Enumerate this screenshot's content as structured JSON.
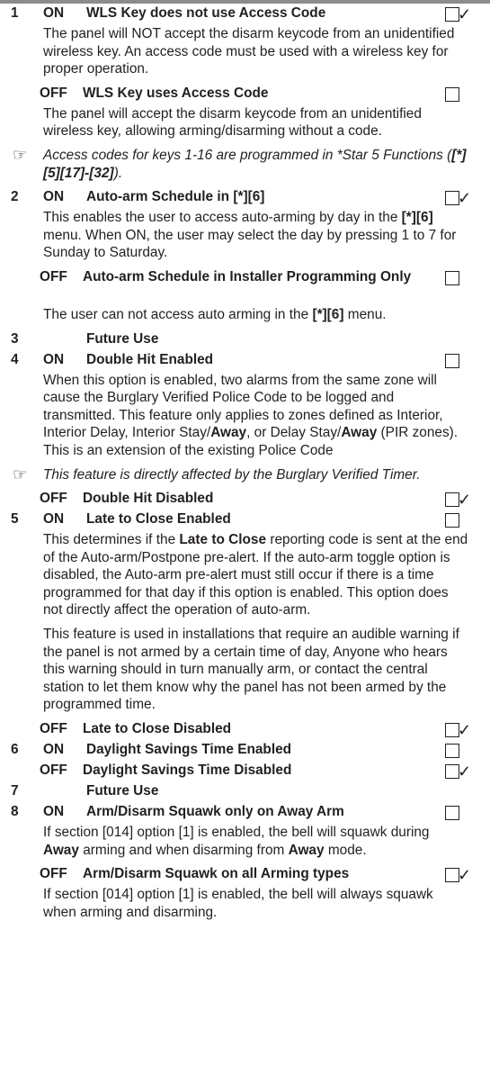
{
  "rows": [
    {
      "type": "opt",
      "num": "1",
      "state": "ON",
      "title": "WLS Key does not use Access Code",
      "checked": true
    },
    {
      "type": "para",
      "text": "The panel will NOT accept the disarm keycode from an unidentified wireless key. An access code must be used with a wireless key for proper operation."
    },
    {
      "type": "opt",
      "num": "",
      "state": "OFF",
      "title": "WLS Key uses Access Code",
      "checked": false
    },
    {
      "type": "para",
      "text": "The panel will accept the disarm keycode from an unidentified wireless key, allowing arming/disarming without a code."
    },
    {
      "type": "note",
      "text": "Access codes for keys 1-16 are programmed in *Star 5 Functions ([*][5][17]-[32])."
    },
    {
      "type": "opt",
      "num": "2",
      "state": "ON",
      "title": "Auto-arm Schedule in [*][6]",
      "checked": true
    },
    {
      "type": "para",
      "text": "This enables the user to access auto-arming by day in the [*][6] menu. When ON, the user may select the day by pressing 1 to 7 for Sunday to Saturday."
    },
    {
      "type": "opt",
      "num": "",
      "state": "OFF",
      "title": "Auto-arm Schedule in Installer Programming Only",
      "checked": false,
      "wrap": true
    },
    {
      "type": "para",
      "text": "The user can not access auto arming in the [*][6] menu."
    },
    {
      "type": "opt",
      "num": "3",
      "state": "",
      "title": "Future Use",
      "nobox": true
    },
    {
      "type": "opt",
      "num": "4",
      "state": "ON",
      "title": "Double Hit Enabled",
      "checked": false
    },
    {
      "type": "para",
      "text": "When this option is enabled, two alarms from the same zone will cause the Burglary Verified Police Code to be logged and transmitted. This feature only applies to zones defined as Interior, Interior Delay, Interior Stay/Away, or Delay Stay/Away (PIR zones). This is an extension of the existing Police Code"
    },
    {
      "type": "note",
      "text": "This feature is directly affected by the Burglary Verified Timer."
    },
    {
      "type": "opt",
      "num": "",
      "state": "OFF",
      "title": "Double Hit Disabled",
      "checked": true
    },
    {
      "type": "opt",
      "num": "5",
      "state": "ON",
      "title": "Late to Close Enabled",
      "checked": false
    },
    {
      "type": "para",
      "text": "This determines if the Late to Close reporting code is sent at the end of the Auto-arm/Postpone pre-alert. If the auto-arm toggle option is disabled, the Auto-arm pre-alert must still occur if there is a time programmed for that day if this option is enabled. This option does not directly affect the operation of auto-arm."
    },
    {
      "type": "para",
      "text": "This feature is used in installations that require an audible warning if the panel is not armed by a certain time of day, Anyone who hears this warning should in turn manually arm, or contact the central station to let them know why the panel has not been armed by the programmed time."
    },
    {
      "type": "opt",
      "num": "",
      "state": "OFF",
      "title": "Late to Close Disabled",
      "checked": true
    },
    {
      "type": "opt",
      "num": "6",
      "state": "ON",
      "title": "Daylight Savings Time Enabled",
      "checked": false
    },
    {
      "type": "opt",
      "num": "",
      "state": "OFF",
      "title": "Daylight Savings Time Disabled",
      "checked": true
    },
    {
      "type": "opt",
      "num": "7",
      "state": "",
      "title": "Future Use",
      "nobox": true
    },
    {
      "type": "opt",
      "num": "8",
      "state": "ON",
      "title": "Arm/Disarm Squawk only on Away Arm",
      "checked": false
    },
    {
      "type": "para",
      "text": "If section [014] option [1] is enabled, the bell will squawk during Away arming and when disarming from Away mode."
    },
    {
      "type": "opt",
      "num": "",
      "state": "OFF",
      "title": "Arm/Disarm Squawk on all Arming types",
      "checked": true
    },
    {
      "type": "para",
      "text": "If section [014] option [1] is enabled, the bell will always squawk when arming and disarming."
    }
  ],
  "icons": {
    "note": "hand-pointer-icon",
    "check": "checkmark-icon"
  }
}
